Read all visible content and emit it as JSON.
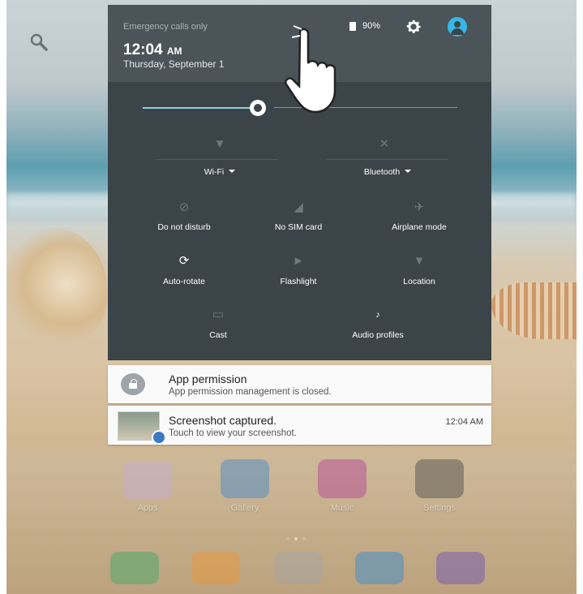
{
  "status": {
    "emergency_text": "Emergency calls only",
    "time": "12:04",
    "time_suffix": "AM",
    "date": "Thursday, September 1",
    "battery": "90%"
  },
  "brightness": {
    "level": 0.49
  },
  "tiles": [
    {
      "label": "Wi-Fi",
      "icon": "wifi-off-icon",
      "active": false,
      "dropdown": true
    },
    {
      "label": "Bluetooth",
      "icon": "bluetooth-off-icon",
      "active": false,
      "dropdown": true
    },
    {
      "label": "Do not disturb",
      "icon": "do-not-disturb-icon",
      "active": false
    },
    {
      "label": "No SIM card",
      "icon": "sim-card-icon",
      "active": false
    },
    {
      "label": "Airplane mode",
      "icon": "airplane-icon",
      "active": false
    },
    {
      "label": "Auto-rotate",
      "icon": "auto-rotate-icon",
      "active": true
    },
    {
      "label": "Flashlight",
      "icon": "flashlight-icon",
      "active": false
    },
    {
      "label": "Location",
      "icon": "location-off-icon",
      "active": false
    },
    {
      "label": "Cast",
      "icon": "cast-icon",
      "active": false
    },
    {
      "label": "Audio profiles",
      "icon": "audio-profiles-icon",
      "active": false
    }
  ],
  "notifications": [
    {
      "title": "App permission",
      "subtitle": "App permission management is closed.",
      "icon": "lock-icon"
    },
    {
      "title": "Screenshot captured.",
      "subtitle": "Touch to view your screenshot.",
      "time": "12:04 AM",
      "icon": "screenshot-thumbnail"
    }
  ],
  "home_apps": [
    {
      "label": "Apps",
      "color": "#c9a7d8"
    },
    {
      "label": "Gallery",
      "color": "#2f7fd0"
    },
    {
      "label": "Music",
      "color": "#b2308f"
    },
    {
      "label": "Settings",
      "color": "#3a3a3a"
    }
  ],
  "dock_apps": [
    {
      "name": "phone",
      "color": "#2aa05a"
    },
    {
      "name": "contacts",
      "color": "#f08a1c"
    },
    {
      "name": "app-drawer",
      "color": "#9c9c9c"
    },
    {
      "name": "messages",
      "color": "#1f7fd0"
    },
    {
      "name": "browser",
      "color": "#5b3fb0"
    }
  ],
  "colors": {
    "panel": "#3b4449",
    "panel_header": "#4a5459",
    "accent": "#36b7e6"
  }
}
